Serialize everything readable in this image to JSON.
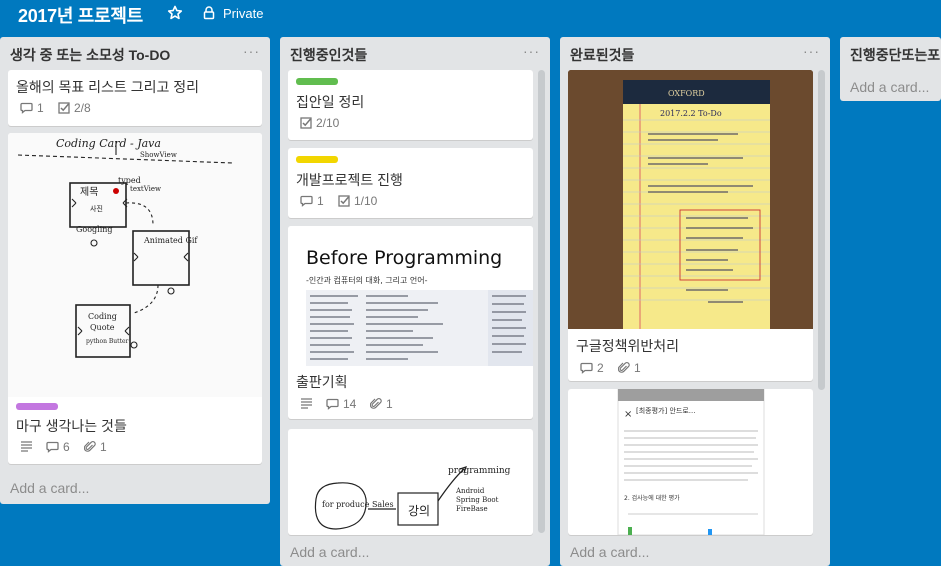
{
  "board": {
    "title": "2017년 프로젝트",
    "visibility": "Private"
  },
  "colors": {
    "background": "#0079bf",
    "list": "#e2e4e6",
    "green_label": "#61bd4f",
    "yellow_label": "#f2d600",
    "purple_label": "#c377e0"
  },
  "lists": [
    {
      "title": "생각 중 또는 소모성 To-DO",
      "menu": "···",
      "add_card": "Add a card...",
      "cards": [
        {
          "title": "올해의 목표 리스트 그리고 정리",
          "comments": "1",
          "checklist": "2/8"
        },
        {
          "title": "마구 생각나는 것들",
          "comments": "6",
          "attachments": "1",
          "image_text": {
            "heading": "Coding Card - Java",
            "show_view": "ShowView",
            "tw": "typed",
            "tfw": "textView",
            "box1_line1": "제목",
            "box1_line2": "사진",
            "box1_line3": "Googling",
            "box2": "Animated Gif",
            "box3_line1": "Coding",
            "box3_line2": "Quote",
            "box3_line3": "python Butter"
          }
        }
      ]
    },
    {
      "title": "진행중인것들",
      "menu": "···",
      "add_card": "Add a card...",
      "cards": [
        {
          "title": "집안일 정리",
          "checklist": "2/10"
        },
        {
          "title": "개발프로젝트 진행",
          "comments": "1",
          "checklist": "1/10"
        },
        {
          "title": "출판기획",
          "comments": "14",
          "attachments": "1",
          "image_text": {
            "heading": "Before Programming",
            "subtitle": "-인간과 컴퓨터의 대화, 그리고 언어-"
          }
        },
        {
          "image_text": {
            "node1": "for produce Sales",
            "node2": "강의",
            "node3": "programming",
            "item1": "Android",
            "item2": "Spring Boot",
            "item3": "FireBase"
          }
        }
      ]
    },
    {
      "title": "완료된것들",
      "menu": "···",
      "add_card": "Add a card...",
      "cards": [
        {
          "title": "구글정책위반처리",
          "comments": "2",
          "attachments": "1",
          "image_text": {
            "brand": "OXFORD",
            "date": "2017.2.2 To-Do"
          }
        },
        {
          "image_text": {
            "title": "[최종평가] 안드로...",
            "section": "2. 검사능에 대한 평가"
          }
        }
      ]
    },
    {
      "title": "진행중단또는포",
      "add_card": "Add a card..."
    }
  ]
}
